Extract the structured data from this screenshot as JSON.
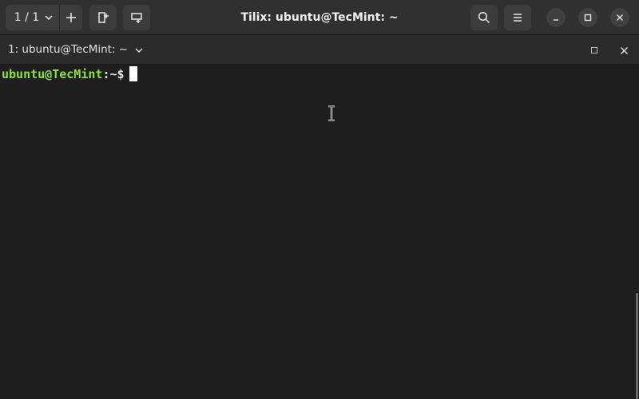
{
  "window": {
    "title": "Tilix: ubuntu@TecMint: ~"
  },
  "headerbar": {
    "session_counter": "1 / 1",
    "icons": {
      "session_dropdown": "chevron-down-icon",
      "add_session": "plus-icon",
      "add_terminal_right": "split-right-icon",
      "add_terminal_down": "split-down-icon",
      "search": "search-icon",
      "menu": "hamburger-menu-icon",
      "minimize": "minimize-icon",
      "maximize": "maximize-icon",
      "close": "close-icon"
    }
  },
  "terminal": {
    "tab_title": "1: ubuntu@TecMint: ~",
    "prompt": {
      "user_host": "ubuntu@TecMint",
      "separator": ":",
      "path": "~$"
    }
  },
  "colors": {
    "headerbar_bg": "#303030",
    "terminal_bg": "#1e1e1e",
    "prompt_user": "#8ae234",
    "text": "#e0e0e0"
  }
}
